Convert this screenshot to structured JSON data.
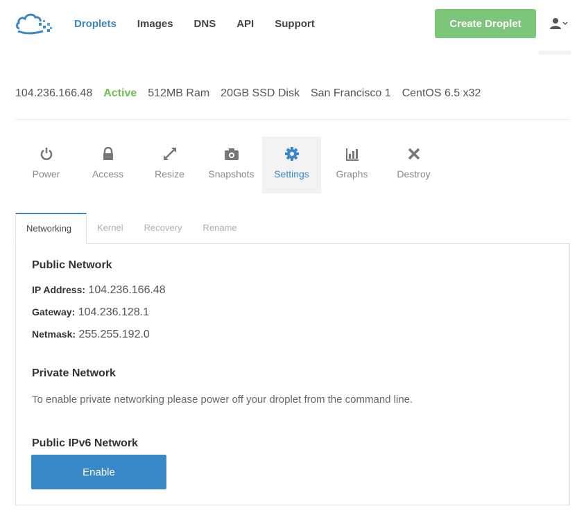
{
  "header": {
    "nav": [
      {
        "label": "Droplets",
        "active": true
      },
      {
        "label": "Images",
        "active": false
      },
      {
        "label": "DNS",
        "active": false
      },
      {
        "label": "API",
        "active": false
      },
      {
        "label": "Support",
        "active": false
      }
    ],
    "create_button": "Create Droplet",
    "user_icon": "user-icon"
  },
  "droplet": {
    "ip": "104.236.166.48",
    "status": "Active",
    "ram": "512MB Ram",
    "disk": "20GB SSD Disk",
    "region": "San Francisco 1",
    "os": "CentOS 6.5 x32"
  },
  "actions": [
    {
      "label": "Power",
      "icon": "power-icon"
    },
    {
      "label": "Access",
      "icon": "lock-icon"
    },
    {
      "label": "Resize",
      "icon": "resize-icon"
    },
    {
      "label": "Snapshots",
      "icon": "camera-icon"
    },
    {
      "label": "Settings",
      "icon": "gear-icon",
      "selected": true
    },
    {
      "label": "Graphs",
      "icon": "bar-chart-icon"
    },
    {
      "label": "Destroy",
      "icon": "close-icon"
    }
  ],
  "subtabs": [
    "Networking",
    "Kernel",
    "Recovery",
    "Rename"
  ],
  "panel": {
    "public_title": "Public Network",
    "ip_label": "IP Address:",
    "ip_value": "104.236.166.48",
    "gateway_label": "Gateway:",
    "gateway_value": "104.236.128.1",
    "netmask_label": "Netmask:",
    "netmask_value": "255.255.192.0",
    "private_title": "Private Network",
    "private_notice": "To enable private networking please power off your droplet from the command line.",
    "ipv6_title": "Public IPv6 Network",
    "enable_button": "Enable"
  },
  "colors": {
    "accent": "#3a87c8",
    "create": "#7bc67b",
    "active_status": "#6cbf55"
  }
}
